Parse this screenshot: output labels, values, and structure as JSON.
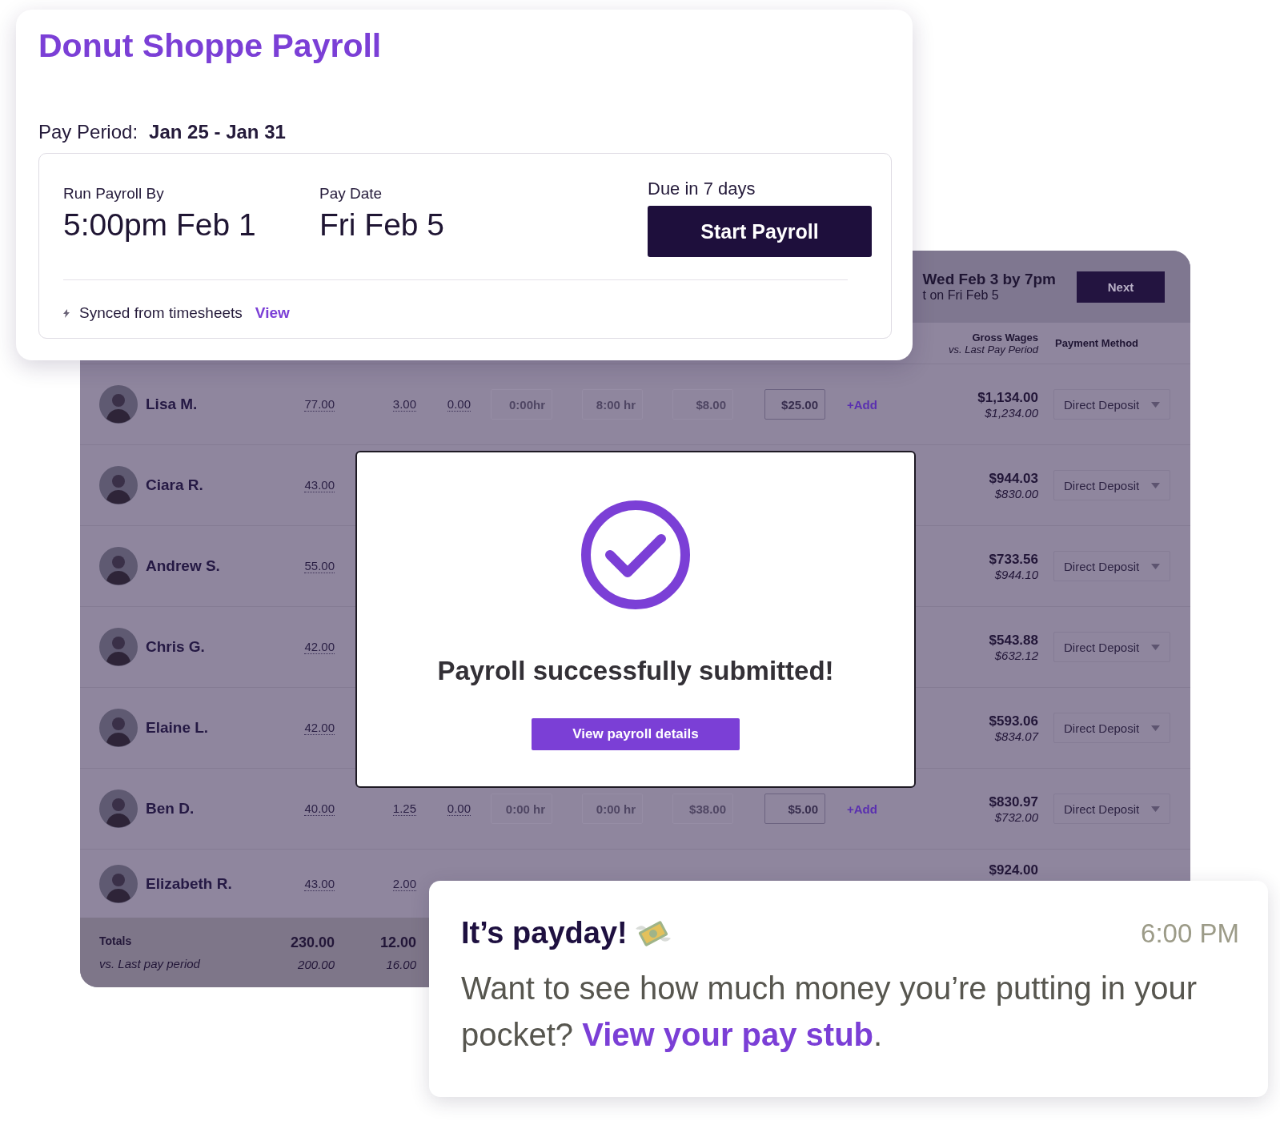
{
  "summary_card": {
    "title": "Donut Shoppe Payroll",
    "pay_period_label": "Pay Period:",
    "pay_period": "Jan 25 - Jan 31",
    "run_by_label": "Run Payroll By",
    "run_by": "5:00pm Feb 1",
    "pay_date_label": "Pay Date",
    "pay_date": "Fri Feb 5",
    "due": "Due in 7 days",
    "start_button": "Start Payroll",
    "sync_text": "Synced from timesheets",
    "sync_link": "View"
  },
  "payroll_table": {
    "deadline": "Wed Feb 3 by 7pm",
    "pay_note": "t on Fri Feb 5",
    "next_button": "Next",
    "columns": {
      "gross": "Gross Wages",
      "gross_sub": "vs. Last Pay Period",
      "payment": "Payment Method"
    },
    "rows": [
      {
        "name": "Lisa M.",
        "hours": [
          "77.00",
          "3.00",
          "0.00"
        ],
        "fields": [
          {
            "value": "0:00hr",
            "disabled": true
          },
          {
            "value": "8:00 hr",
            "disabled": true
          },
          {
            "value": "$8.00",
            "disabled": true
          },
          {
            "value": "$25.00",
            "disabled": false
          }
        ],
        "add": "+Add",
        "gross": "$1,134.00",
        "last_gross": "$1,234.00",
        "payment": "Direct Deposit"
      },
      {
        "name": "Ciara R.",
        "hours": [
          "43.00"
        ],
        "gross": "$944.03",
        "last_gross": "$830.00",
        "payment": "Direct Deposit"
      },
      {
        "name": "Andrew S.",
        "hours": [
          "55.00"
        ],
        "gross": "$733.56",
        "last_gross": "$944.10",
        "payment": "Direct Deposit"
      },
      {
        "name": "Chris G.",
        "hours": [
          "42.00"
        ],
        "gross": "$543.88",
        "last_gross": "$632.12",
        "payment": "Direct Deposit"
      },
      {
        "name": "Elaine L.",
        "hours": [
          "42.00"
        ],
        "gross": "$593.06",
        "last_gross": "$834.07",
        "payment": "Direct Deposit"
      },
      {
        "name": "Ben D.",
        "hours": [
          "40.00",
          "1.25",
          "0.00"
        ],
        "fields": [
          {
            "value": "0:00 hr",
            "disabled": true
          },
          {
            "value": "0:00 hr",
            "disabled": true
          },
          {
            "value": "$38.00",
            "disabled": true
          },
          {
            "value": "$5.00",
            "disabled": false
          }
        ],
        "add": "+Add",
        "gross": "$830.97",
        "last_gross": "$732.00",
        "payment": "Direct Deposit"
      },
      {
        "name": "Elizabeth R.",
        "hours": [
          "43.00",
          "2.00"
        ],
        "gross": "$924.00"
      }
    ],
    "totals": {
      "label": "Totals",
      "sub_label": "vs. Last pay period",
      "values": [
        {
          "value": "230.00",
          "last": "200.00"
        },
        {
          "value": "12.00",
          "last": "16.00"
        }
      ]
    }
  },
  "modal": {
    "message": "Payroll successfully submitted!",
    "button": "View payroll details"
  },
  "notification": {
    "title": "It’s payday!",
    "time": "6:00 PM",
    "text": "Want to see how much money you’re putting in your pocket?",
    "link": "View your pay stub",
    "tail": "."
  }
}
